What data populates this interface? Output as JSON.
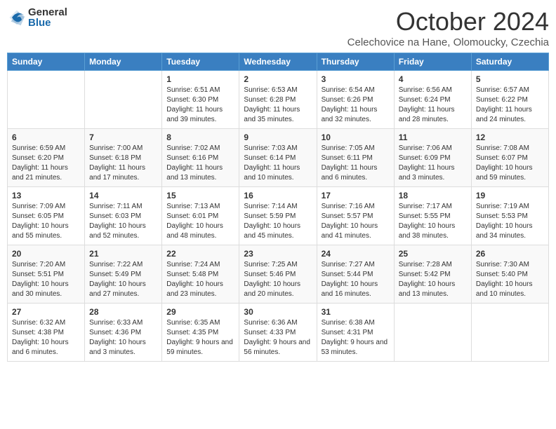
{
  "logo": {
    "general": "General",
    "blue": "Blue"
  },
  "title": "October 2024",
  "subtitle": "Celechovice na Hane, Olomoucky, Czechia",
  "weekdays": [
    "Sunday",
    "Monday",
    "Tuesday",
    "Wednesday",
    "Thursday",
    "Friday",
    "Saturday"
  ],
  "weeks": [
    [
      null,
      null,
      {
        "day": 1,
        "sunrise": "6:51 AM",
        "sunset": "6:30 PM",
        "daylight": "11 hours and 39 minutes."
      },
      {
        "day": 2,
        "sunrise": "6:53 AM",
        "sunset": "6:28 PM",
        "daylight": "11 hours and 35 minutes."
      },
      {
        "day": 3,
        "sunrise": "6:54 AM",
        "sunset": "6:26 PM",
        "daylight": "11 hours and 32 minutes."
      },
      {
        "day": 4,
        "sunrise": "6:56 AM",
        "sunset": "6:24 PM",
        "daylight": "11 hours and 28 minutes."
      },
      {
        "day": 5,
        "sunrise": "6:57 AM",
        "sunset": "6:22 PM",
        "daylight": "11 hours and 24 minutes."
      }
    ],
    [
      {
        "day": 6,
        "sunrise": "6:59 AM",
        "sunset": "6:20 PM",
        "daylight": "11 hours and 21 minutes."
      },
      {
        "day": 7,
        "sunrise": "7:00 AM",
        "sunset": "6:18 PM",
        "daylight": "11 hours and 17 minutes."
      },
      {
        "day": 8,
        "sunrise": "7:02 AM",
        "sunset": "6:16 PM",
        "daylight": "11 hours and 13 minutes."
      },
      {
        "day": 9,
        "sunrise": "7:03 AM",
        "sunset": "6:14 PM",
        "daylight": "11 hours and 10 minutes."
      },
      {
        "day": 10,
        "sunrise": "7:05 AM",
        "sunset": "6:11 PM",
        "daylight": "11 hours and 6 minutes."
      },
      {
        "day": 11,
        "sunrise": "7:06 AM",
        "sunset": "6:09 PM",
        "daylight": "11 hours and 3 minutes."
      },
      {
        "day": 12,
        "sunrise": "7:08 AM",
        "sunset": "6:07 PM",
        "daylight": "10 hours and 59 minutes."
      }
    ],
    [
      {
        "day": 13,
        "sunrise": "7:09 AM",
        "sunset": "6:05 PM",
        "daylight": "10 hours and 55 minutes."
      },
      {
        "day": 14,
        "sunrise": "7:11 AM",
        "sunset": "6:03 PM",
        "daylight": "10 hours and 52 minutes."
      },
      {
        "day": 15,
        "sunrise": "7:13 AM",
        "sunset": "6:01 PM",
        "daylight": "10 hours and 48 minutes."
      },
      {
        "day": 16,
        "sunrise": "7:14 AM",
        "sunset": "5:59 PM",
        "daylight": "10 hours and 45 minutes."
      },
      {
        "day": 17,
        "sunrise": "7:16 AM",
        "sunset": "5:57 PM",
        "daylight": "10 hours and 41 minutes."
      },
      {
        "day": 18,
        "sunrise": "7:17 AM",
        "sunset": "5:55 PM",
        "daylight": "10 hours and 38 minutes."
      },
      {
        "day": 19,
        "sunrise": "7:19 AM",
        "sunset": "5:53 PM",
        "daylight": "10 hours and 34 minutes."
      }
    ],
    [
      {
        "day": 20,
        "sunrise": "7:20 AM",
        "sunset": "5:51 PM",
        "daylight": "10 hours and 30 minutes."
      },
      {
        "day": 21,
        "sunrise": "7:22 AM",
        "sunset": "5:49 PM",
        "daylight": "10 hours and 27 minutes."
      },
      {
        "day": 22,
        "sunrise": "7:24 AM",
        "sunset": "5:48 PM",
        "daylight": "10 hours and 23 minutes."
      },
      {
        "day": 23,
        "sunrise": "7:25 AM",
        "sunset": "5:46 PM",
        "daylight": "10 hours and 20 minutes."
      },
      {
        "day": 24,
        "sunrise": "7:27 AM",
        "sunset": "5:44 PM",
        "daylight": "10 hours and 16 minutes."
      },
      {
        "day": 25,
        "sunrise": "7:28 AM",
        "sunset": "5:42 PM",
        "daylight": "10 hours and 13 minutes."
      },
      {
        "day": 26,
        "sunrise": "7:30 AM",
        "sunset": "5:40 PM",
        "daylight": "10 hours and 10 minutes."
      }
    ],
    [
      {
        "day": 27,
        "sunrise": "6:32 AM",
        "sunset": "4:38 PM",
        "daylight": "10 hours and 6 minutes."
      },
      {
        "day": 28,
        "sunrise": "6:33 AM",
        "sunset": "4:36 PM",
        "daylight": "10 hours and 3 minutes."
      },
      {
        "day": 29,
        "sunrise": "6:35 AM",
        "sunset": "4:35 PM",
        "daylight": "9 hours and 59 minutes."
      },
      {
        "day": 30,
        "sunrise": "6:36 AM",
        "sunset": "4:33 PM",
        "daylight": "9 hours and 56 minutes."
      },
      {
        "day": 31,
        "sunrise": "6:38 AM",
        "sunset": "4:31 PM",
        "daylight": "9 hours and 53 minutes."
      },
      null,
      null
    ]
  ]
}
